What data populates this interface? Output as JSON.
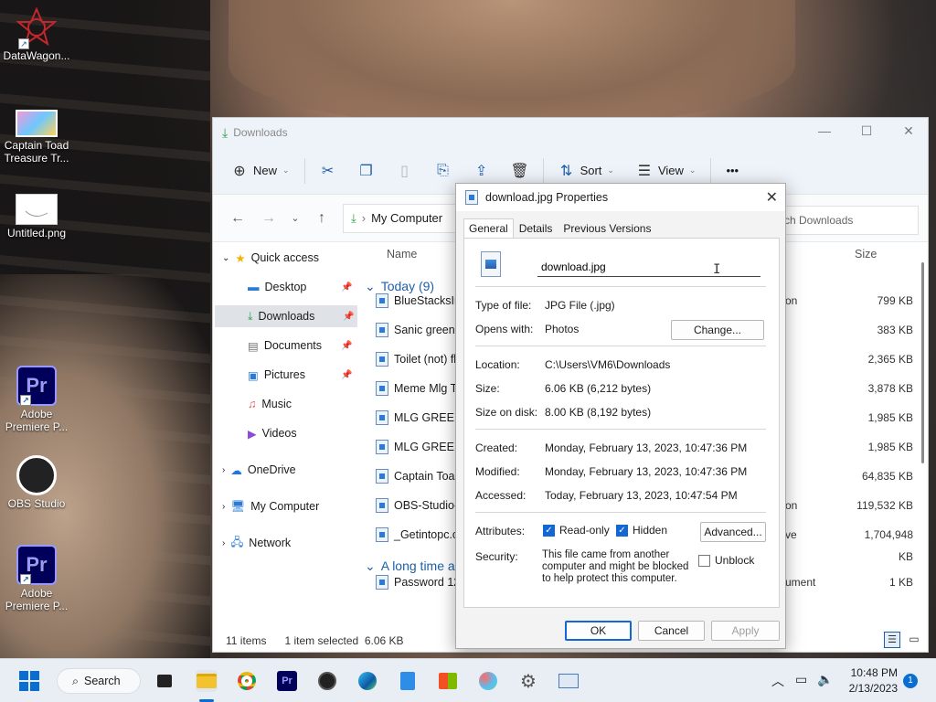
{
  "desktop": {
    "icons": [
      {
        "label": "DataWagon..."
      },
      {
        "label": "Captain Toad Treasure Tr..."
      },
      {
        "label": "Untitled.png"
      },
      {
        "label": "Adobe Premiere P...",
        "glyph": "Pr"
      },
      {
        "label": "OBS Studio"
      },
      {
        "label": "Adobe Premiere P...",
        "glyph": "Pr"
      }
    ]
  },
  "explorer": {
    "title": "Downloads",
    "toolbar": {
      "new": "New",
      "sort": "Sort",
      "view": "View",
      "more": "•••"
    },
    "path": "My Computer",
    "search_placeholder": "rch Downloads",
    "columns": {
      "name": "Name",
      "size": "Size"
    },
    "nav": {
      "quick_access": "Quick access",
      "desktop": "Desktop",
      "downloads": "Downloads",
      "documents": "Documents",
      "pictures": "Pictures",
      "music": "Music",
      "videos": "Videos",
      "onedrive": "OneDrive",
      "my_computer": "My Computer",
      "network": "Network"
    },
    "groups": {
      "today": "Today (9)",
      "long_ago": "A long time a"
    },
    "files": [
      {
        "name": "BlueStacksIns",
        "type": "on",
        "size": "799 KB"
      },
      {
        "name": "Sanic green s",
        "type": "",
        "size": "383 KB"
      },
      {
        "name": "Toilet (not) fl",
        "type": "",
        "size": "2,365 KB"
      },
      {
        "name": "Meme Mlg Tr",
        "type": "",
        "size": "3,878 KB"
      },
      {
        "name": "MLG GREEN S",
        "type": "",
        "size": "1,985 KB"
      },
      {
        "name": "MLG GREEN S",
        "type": "",
        "size": "1,985 KB"
      },
      {
        "name": "Captain Toad",
        "type": "",
        "size": "64,835 KB"
      },
      {
        "name": "OBS-Studio-2",
        "type": "on",
        "size": "119,532 KB"
      },
      {
        "name": "_Getintopc.com",
        "type": "ve",
        "size": "1,704,948 KB"
      },
      {
        "name": "Password 123",
        "type": "ument",
        "size": "1 KB"
      }
    ],
    "status": {
      "items": "11 items",
      "selected": "1 item selected",
      "size": "6.06 KB"
    }
  },
  "dialog": {
    "title": "download.jpg Properties",
    "tabs": [
      "General",
      "Details",
      "Previous Versions"
    ],
    "filename": "download.jpg",
    "type_label": "Type of file:",
    "type_value": "JPG File (.jpg)",
    "opens_label": "Opens with:",
    "opens_value": "Photos",
    "change": "Change...",
    "location_label": "Location:",
    "location_value": "C:\\Users\\VM6\\Downloads",
    "size_label": "Size:",
    "size_value": "6.06 KB (6,212 bytes)",
    "disk_label": "Size on disk:",
    "disk_value": "8.00 KB (8,192 bytes)",
    "created_label": "Created:",
    "created_value": "Monday, February 13, 2023, 10:47:36 PM",
    "modified_label": "Modified:",
    "modified_value": "Monday, February 13, 2023, 10:47:36 PM",
    "accessed_label": "Accessed:",
    "accessed_value": "Today, February 13, 2023, 10:47:54 PM",
    "attributes_label": "Attributes:",
    "readonly": "Read-only",
    "hidden": "Hidden",
    "advanced": "Advanced...",
    "security_label": "Security:",
    "security_text": "This file came from another computer and might be blocked to help protect this computer.",
    "unblock": "Unblock",
    "ok": "OK",
    "cancel": "Cancel",
    "apply": "Apply"
  },
  "taskbar": {
    "search": "Search",
    "time": "10:48 PM",
    "date": "2/13/2023",
    "notifications": "1"
  }
}
